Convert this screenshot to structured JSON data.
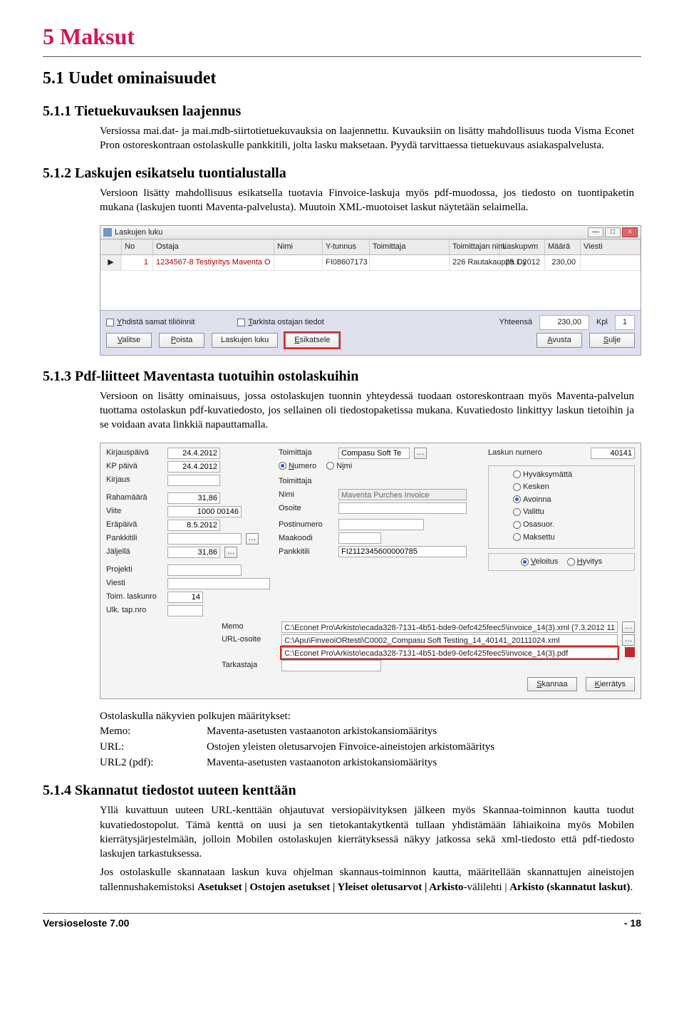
{
  "h1": "5   Maksut",
  "h2_1": "5.1 Uudet ominaisuudet",
  "h3_1": "5.1.1 Tietuekuvauksen laajennus",
  "p1": "Versiossa mai.dat- ja mai.mdb-siirtotietuekuvauksia on laajennettu. Kuvauksiin on lisätty mahdollisuus tuoda Visma Econet Pron ostoreskontraan ostolaskulle pankkitili, jolta lasku maksetaan. Pyydä tarvittaessa tietuekuvaus asiakaspalvelusta.",
  "h3_2": "5.1.2 Laskujen esikatselu tuontialustalla",
  "p2": "Versioon lisätty mahdollisuus esikatsella tuotavia Finvoice-laskuja myös pdf-muodossa, jos tiedosto on tuontipaketin mukana (laskujen tuonti Maventa-palvelusta). Muutoin XML-muotoiset laskut näytetään selaimella.",
  "s1": {
    "title": "Laskujen luku",
    "cols": [
      "",
      "No",
      "Ostaja",
      "Nimi",
      "Y-tunnus",
      "Toimittaja",
      "Toimittajan nimi",
      "Laskupvm",
      "Määrä",
      "Viesti"
    ],
    "row": {
      "no": "1",
      "ostaja": "1234567-8 Testiyritys Maventa O",
      "nimi": "",
      "ytunnus": "FI08607173",
      "toimittaja": "",
      "toimnimi": "226 Rautakauppa Oy",
      "laskupvm": "25.1.2012",
      "maara": "230,00",
      "viesti": ""
    },
    "chk1": "Yhdistä samat tiliöinnit",
    "chk2": "Tarkista ostajan tiedot",
    "yhteensa_lbl": "Yhteensä",
    "yhteensa_val": "230,00",
    "kpl_lbl": "Kpl",
    "kpl_val": "1",
    "btns": {
      "valitse": "Valitse",
      "poista": "Poista",
      "laskujenluku": "Laskujen luku",
      "esikatsele": "Esikatsele",
      "avusta": "Avusta",
      "sulje": "Sulje"
    }
  },
  "h3_3": "5.1.3 Pdf-liitteet Maventasta tuotuihin ostolaskuihin",
  "p3": "Versioon on lisätty ominaisuus, jossa ostolaskujen tuonnin yhteydessä tuodaan ostoreskontraan myös Maventa-palvelun tuottama ostolaskun pdf-kuvatiedosto, jos sellainen oli tiedostopaketissa mukana. Kuvatiedosto linkittyy laskun tietoihin ja se voidaan avata linkkiä napauttamalla.",
  "s2": {
    "labels": {
      "kirjauspv": "Kirjauspäivä",
      "kppaiva": "KP päivä",
      "kirjaus": "Kirjaus",
      "rahamaara": "Rahamäärä",
      "viite": "Viite",
      "erapaiva": "Eräpäivä",
      "pankkitili": "Pankkitili",
      "jaljella": "Jäljellä",
      "projekti": "Projekti",
      "viesti": "Viesti",
      "toimlaskunro": "Toim. laskunro",
      "ulktapnro": "Ulk. tap.nro",
      "toimittaja": "Toimittaja",
      "numero": "Numero",
      "laskunnumero": "Laskun numero",
      "toimittaja2": "Toimittaja",
      "nimi_r": "Nimi",
      "nimi": "Nimi",
      "osoite": "Osoite",
      "postinumero": "Postinumero",
      "maakoodi": "Maakoodi",
      "pankkitili2": "Pankkitili",
      "memo": "Memo",
      "urlosoite": "URL-osoite",
      "tarkastaja": "Tarkastaja",
      "veloitus": "Veloitus",
      "hyvitys": "Hyvitys",
      "skannaa": "Skannaa",
      "kierratys": "Kierrätys"
    },
    "status": [
      "Hyväksymättä",
      "Kesken",
      "Avoinna",
      "Valittu",
      "Osasuor.",
      "Maksettu"
    ],
    "status_sel": 2,
    "vals": {
      "kirjauspv": "24.4.2012",
      "kppaiva": "24.4.2012",
      "rahamaara": "31,86",
      "viite": "1000 00146",
      "erapaiva": "8.5.2012",
      "jaljella": "31,86",
      "toimlaskunro": "14",
      "toimittaja": "Compasu Soft Te",
      "laskunnumero": "40141",
      "nimi": "Maventa Purches Invoice",
      "pankkitili2": "FI2112345600000785",
      "memo1": "C:\\Econet Pro\\Arkisto\\ecada328-7131-4b51-bde9-0efc425feec5\\invoice_14(3).xml (7.3.2012 11",
      "memo2": "C:\\Apu\\FinveoiORtesti\\C0002_Compasu Soft Testing_14_40141_20111024.xml",
      "memo3": "C:\\Econet Pro\\Arkisto\\ecada328-7131-4b51-bde9-0efc425feec5\\invoice_14(3).pdf"
    }
  },
  "def_title": "Ostolaskulla näkyvien polkujen määritykset:",
  "defs": [
    {
      "t": "Memo:",
      "d": "Maventa-asetusten vastaanoton arkistokansiomääritys"
    },
    {
      "t": "URL:",
      "d": "Ostojen yleisten oletusarvojen Finvoice-aineistojen arkistomääritys"
    },
    {
      "t": "URL2 (pdf):",
      "d": "Maventa-asetusten vastaanoton arkistokansiomääritys"
    }
  ],
  "h3_4": "5.1.4 Skannatut tiedostot uuteen kenttään",
  "p4a": "Yllä kuvattuun uuteen URL-kenttään ohjautuvat versiopäivityksen jälkeen myös Skannaa-toiminnon kautta tuodut kuvatiedostopolut. Tämä kenttä on uusi ja sen tietokantakytkentä tullaan yhdistämään lähiaikoina myös Mobilen kierrätysjärjestelmään, jolloin Mobilen ostolaskujen kierrätyksessä näkyy jatkossa sekä xml-tiedosto että pdf-tiedosto laskujen tarkastuksessa.",
  "p4b_pre": "Jos ostolaskulle skannataan laskun kuva ohjelman skannaus-toiminnon kautta, määritellään skannattujen aineistojen tallennushakemistoksi ",
  "p4b_bold": "Asetukset | Ostojen asetukset | Yleiset oletusarvot | Arkisto",
  "p4b_mid": "-välilehti | ",
  "p4b_bold2": "Arkisto (skannatut laskut)",
  "p4b_end": ".",
  "footer_l": "Versioseloste 7.00",
  "footer_r": "- 18"
}
